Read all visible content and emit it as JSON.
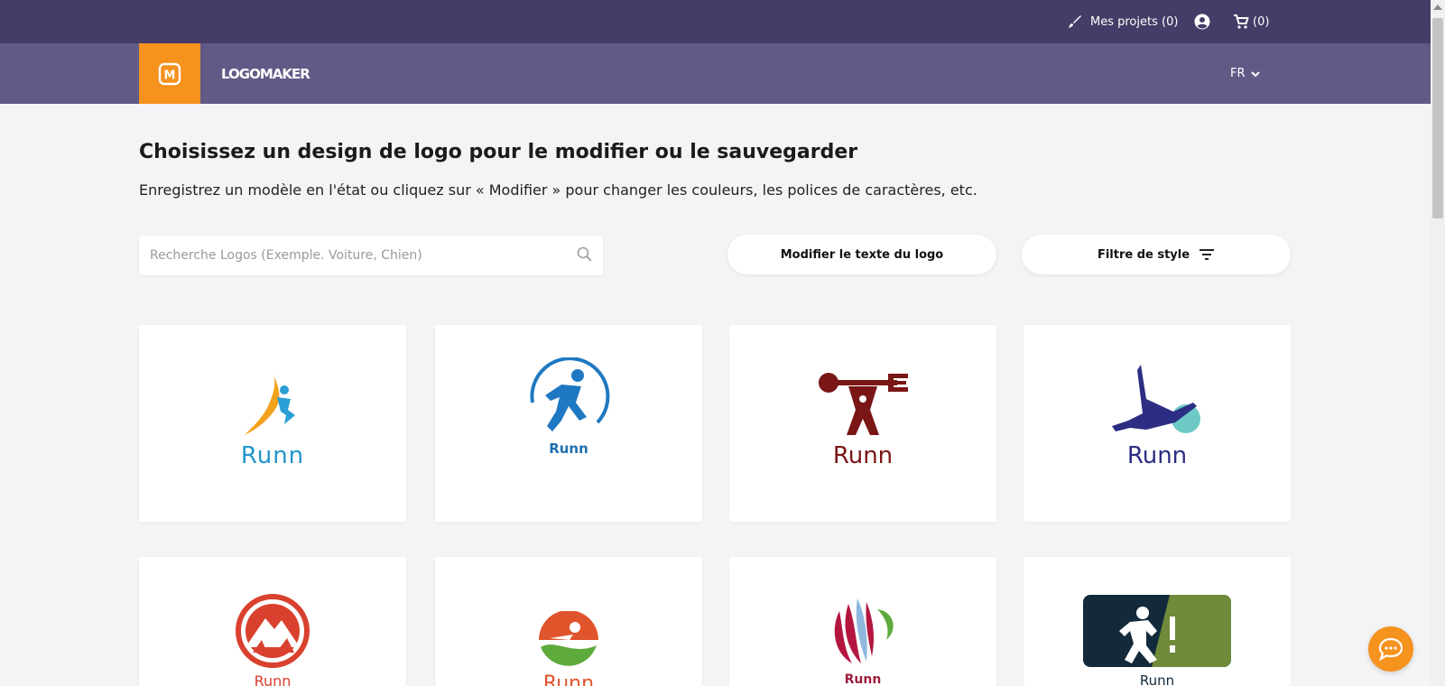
{
  "topbar": {
    "projects_label": "Mes projets (0)",
    "cart_label": "(0)"
  },
  "navbar": {
    "logo_letter": "M",
    "brand": "LOGOMAKER",
    "language": "FR"
  },
  "main": {
    "title": "Choisissez un design de logo pour le modifier ou le sauvegarder",
    "subtitle": "Enregistrez un modèle en l'état ou cliquez sur « Modifier » pour changer les couleurs, les polices de caractères, etc.",
    "search_placeholder": "Recherche Logos (Exemple. Voiture, Chien)",
    "edit_text_button": "Modifier le texte du logo",
    "style_filter_button": "Filtre de style"
  },
  "logos": [
    {
      "name": "Runn",
      "color": "#2196c9"
    },
    {
      "name": "Runn",
      "color": "#1f6fb0"
    },
    {
      "name": "Runn",
      "color": "#7a1616"
    },
    {
      "name": "Runn",
      "color": "#2c2e83"
    },
    {
      "name": "Runn",
      "color": "#d9402e"
    },
    {
      "name": "Runn",
      "color": "#e0542c"
    },
    {
      "name": "Runn",
      "color": "#9c1e3e"
    },
    {
      "name": "Runn",
      "color": "#132a3b"
    }
  ],
  "colors": {
    "topbar": "#443d67",
    "navbar": "#625a86",
    "accent": "#f6921e",
    "background": "#f4f4f6"
  }
}
